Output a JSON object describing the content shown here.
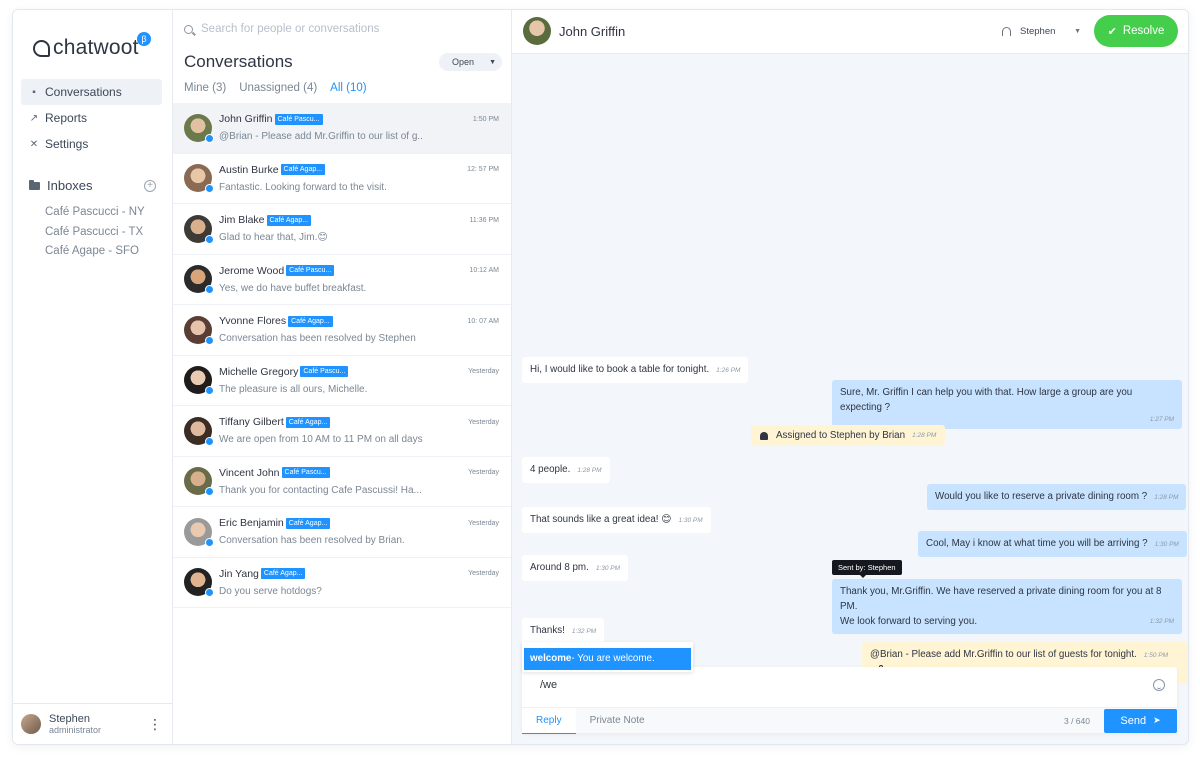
{
  "sidebar": {
    "logo_text": "chatwoot",
    "beta": "β",
    "nav": [
      {
        "label": "Conversations",
        "icon": "chat-bubble-icon"
      },
      {
        "label": "Reports",
        "icon": "trend-icon"
      },
      {
        "label": "Settings",
        "icon": "tools-icon"
      }
    ],
    "inboxes_label": "Inboxes",
    "inboxes": [
      "Café Pascucci - NY",
      "Café Pascucci - TX",
      "Café Agape - SFO"
    ],
    "profile": {
      "name": "Stephen",
      "role": "administrator"
    }
  },
  "conversations": {
    "search_placeholder": "Search for people or conversations",
    "title": "Conversations",
    "status": "Open",
    "tabs": [
      "Mine (3)",
      "Unassigned (4)",
      "All (10)"
    ],
    "rows": [
      {
        "name": "John Griffin",
        "inbox": "Café Pascu...",
        "time": "1:50 PM",
        "message": "@Brian - Please add Mr.Griffin to our list of g.."
      },
      {
        "name": "Austin Burke",
        "inbox": "Café Agap...",
        "time": "12: 57 PM",
        "message": "Fantastic. Looking forward to the visit."
      },
      {
        "name": "Jim Blake",
        "inbox": "Café Agap...",
        "time": "11:36 PM",
        "message": "Glad to hear that, Jim.😊"
      },
      {
        "name": "Jerome Wood",
        "inbox": "Café Pascu...",
        "time": "10:12 AM",
        "message": "Yes, we do have buffet breakfast."
      },
      {
        "name": "Yvonne Flores",
        "inbox": "Café Agap...",
        "time": "10: 07 AM",
        "message": "Conversation has been resolved by Stephen"
      },
      {
        "name": "Michelle Gregory",
        "inbox": "Café Pascu...",
        "time": "Yesterday",
        "message": "The pleasure is all ours, Michelle."
      },
      {
        "name": "Tiffany Gilbert",
        "inbox": "Café Agap...",
        "time": "Yesterday",
        "message": "We are open from 10 AM to 11 PM on all days"
      },
      {
        "name": "Vincent John",
        "inbox": "Café Pascu...",
        "time": "Yesterday",
        "message": "Thank you for contacting Cafe Pascussi! Ha..."
      },
      {
        "name": "Eric Benjamin",
        "inbox": "Café Agap...",
        "time": "Yesterday",
        "message": "Conversation has been resolved by Brian."
      },
      {
        "name": "Jin Yang",
        "inbox": "Café Agap...",
        "time": "Yesterday",
        "message": "Do you serve hotdogs?"
      }
    ]
  },
  "chat": {
    "contact_name": "John Griffin",
    "agent": "Stephen",
    "resolve_label": "Resolve",
    "messages": {
      "m1": {
        "text": "Hi, I would like to book a table for tonight.",
        "time": "1:26 PM"
      },
      "m2": {
        "text": "Sure, Mr. Griffin I can help you with that. How large a group are you expecting ?",
        "time": "1:27 PM"
      },
      "m3": {
        "text": "Assigned to Stephen by Brian",
        "time": "1:28 PM"
      },
      "m4": {
        "text": "4 people.",
        "time": "1:28 PM"
      },
      "m5": {
        "text": "Would you like to reserve a private dining room ?",
        "time": "1:28 PM"
      },
      "m6": {
        "text": "That sounds like a great idea! 😊",
        "time": "1:30 PM"
      },
      "m7": {
        "text": "Cool, May i know at what time you will be arriving ?",
        "time": "1:30 PM"
      },
      "m8": {
        "text": "Around 8 pm.",
        "time": "1:30 PM"
      },
      "m9_line1": "Thank you, Mr.Griffin. We have reserved a private dining room for you at 8 PM.",
      "m9_line2": "We look forward to serving you.",
      "m9_time": "1:32 PM",
      "tooltip": "Sent by: Stephen",
      "m10": {
        "text": "Thanks!",
        "time": "1:32 PM"
      },
      "note": {
        "text": "@Brian - Please add Mr.Griffin to our list of guests for tonight.",
        "time": "1:50 PM"
      }
    },
    "canned": {
      "key": "welcome",
      "text": "- You are welcome."
    },
    "reply": {
      "input_value": "/we",
      "tab_reply": "Reply",
      "tab_note": "Private Note",
      "char_count": "3 / 640",
      "send_label": "Send"
    }
  }
}
